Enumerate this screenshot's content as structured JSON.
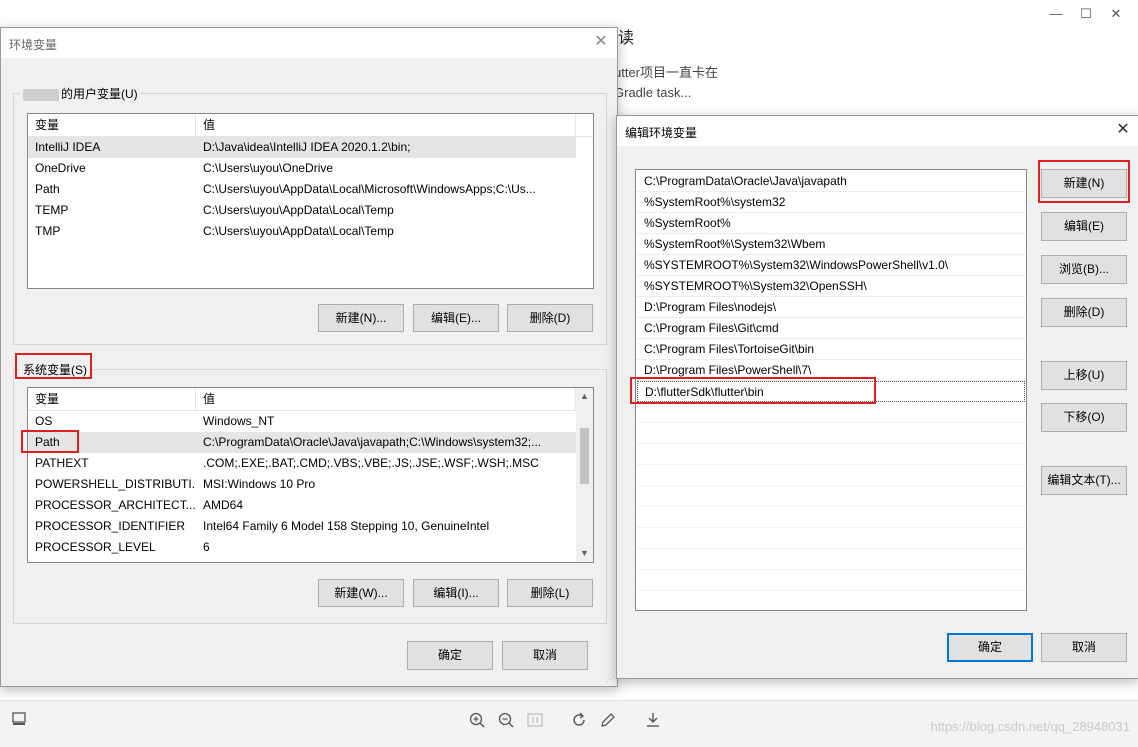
{
  "background": {
    "blog_heading_fragment": "读",
    "blog_line1": "utter项目一直卡在",
    "blog_line2": "Gradle task...",
    "watermark": "https://blog.csdn.net/qq_28948031",
    "window_controls": {
      "minimize": "—",
      "maximize": "☐",
      "close": "✕"
    }
  },
  "env_dialog": {
    "title": "环境变量",
    "user_group_label": "的用户变量(U)",
    "columns": {
      "var": "变量",
      "value": "值"
    },
    "user_vars": [
      {
        "name": "IntelliJ IDEA",
        "value": "D:\\Java\\idea\\IntelliJ IDEA 2020.1.2\\bin;"
      },
      {
        "name": "OneDrive",
        "value": "C:\\Users\\uyou\\OneDrive"
      },
      {
        "name": "Path",
        "value": "C:\\Users\\uyou\\AppData\\Local\\Microsoft\\WindowsApps;C:\\Us..."
      },
      {
        "name": "TEMP",
        "value": "C:\\Users\\uyou\\AppData\\Local\\Temp"
      },
      {
        "name": "TMP",
        "value": "C:\\Users\\uyou\\AppData\\Local\\Temp"
      }
    ],
    "user_buttons": {
      "new": "新建(N)...",
      "edit": "编辑(E)...",
      "delete": "删除(D)"
    },
    "system_group_label": "系统变量(S)",
    "system_vars": [
      {
        "name": "OS",
        "value": "Windows_NT"
      },
      {
        "name": "Path",
        "value": "C:\\ProgramData\\Oracle\\Java\\javapath;C:\\Windows\\system32;..."
      },
      {
        "name": "PATHEXT",
        "value": ".COM;.EXE;.BAT;.CMD;.VBS;.VBE;.JS;.JSE;.WSF;.WSH;.MSC"
      },
      {
        "name": "POWERSHELL_DISTRIBUTI...",
        "value": "MSI:Windows 10 Pro"
      },
      {
        "name": "PROCESSOR_ARCHITECT...",
        "value": "AMD64"
      },
      {
        "name": "PROCESSOR_IDENTIFIER",
        "value": "Intel64 Family 6 Model 158 Stepping 10, GenuineIntel"
      },
      {
        "name": "PROCESSOR_LEVEL",
        "value": "6"
      }
    ],
    "system_buttons": {
      "new": "新建(W)...",
      "edit": "编辑(I)...",
      "delete": "删除(L)"
    },
    "ok": "确定",
    "cancel": "取消"
  },
  "edit_dialog": {
    "title": "编辑环境变量",
    "paths": [
      "C:\\ProgramData\\Oracle\\Java\\javapath",
      "%SystemRoot%\\system32",
      "%SystemRoot%",
      "%SystemRoot%\\System32\\Wbem",
      "%SYSTEMROOT%\\System32\\WindowsPowerShell\\v1.0\\",
      "%SYSTEMROOT%\\System32\\OpenSSH\\",
      "D:\\Program Files\\nodejs\\",
      "C:\\Program Files\\Git\\cmd",
      "C:\\Program Files\\TortoiseGit\\bin",
      "D:\\Program Files\\PowerShell\\7\\",
      "D:\\flutterSdk\\flutter\\bin"
    ],
    "buttons": {
      "new": "新建(N)",
      "edit": "编辑(E)",
      "browse": "浏览(B)...",
      "delete": "删除(D)",
      "move_up": "上移(U)",
      "move_down": "下移(O)",
      "edit_text": "编辑文本(T)..."
    },
    "ok": "确定",
    "cancel": "取消"
  }
}
